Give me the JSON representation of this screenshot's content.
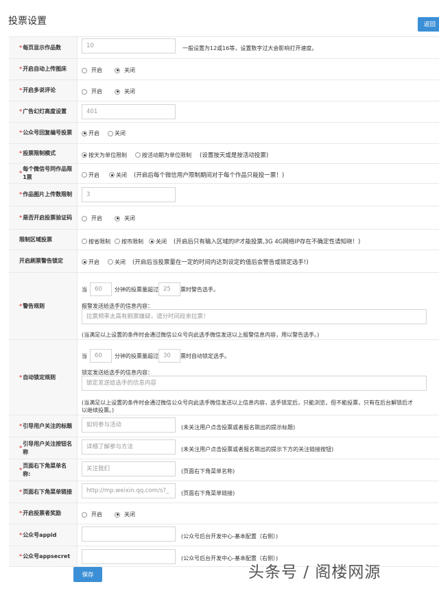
{
  "header": {
    "title": "投票设置",
    "back_label": "返回"
  },
  "rows": {
    "per_page": {
      "label": "每页显示作品数",
      "value": "10",
      "hint": "一般设置为12或16等，设置数字过大会影响打开速度。"
    },
    "auto_upload": {
      "label": "开启自动上传图床",
      "opt_on": "开启",
      "opt_off": "关闭",
      "selected": "关闭"
    },
    "multi_comment": {
      "label": "开启多说评论",
      "opt_on": "开启",
      "opt_off": "关闭",
      "selected": "关闭"
    },
    "ad_height": {
      "label": "广告幻灯高度设置",
      "value": "401"
    },
    "reply_number": {
      "label": "公众号回复编号投票",
      "opt_on": "开启",
      "opt_off": "关闭",
      "selected": "开启"
    },
    "vote_limit": {
      "label": "投票限制模式",
      "opt_day": "按天为单位限制",
      "opt_period": "按活动期为单位限制",
      "hint": "(设置按天或是按活动投票)",
      "selected": "按天为单位限制"
    },
    "one_vote": {
      "label": "每个微信号同作品限1票",
      "opt_on": "开启",
      "opt_off": "关闭",
      "hint": "(开启后每个微信用户限制期间对于每个作品只能投一票！)",
      "selected": "关闭"
    },
    "upload_limit": {
      "label": "作品图片上传数限制",
      "value": "3"
    },
    "captcha": {
      "label": "是否开启投票验证码",
      "opt_on": "开启",
      "opt_off": "关闭",
      "selected": "关闭"
    },
    "region": {
      "label": "限制区域投票",
      "opt_province": "按省限制",
      "opt_city": "按市限制",
      "opt_off": "关闭",
      "hint": "(开启后只有输入区域的IP才能投票,3G 4G网络IP存在不确定性请知晓！)",
      "selected": "关闭"
    },
    "brush_warn": {
      "label": "开启刷票警告锁定",
      "opt_on": "开启",
      "opt_off": "关闭",
      "hint": "(开启后当投票量在一定的时间内达到设定的值后会警告或锁定选手!)",
      "selected": "开启"
    },
    "warn_rule": {
      "label": "警告规则",
      "prefix": "当",
      "minutes": "60",
      "mid": "分钟的投票量超过",
      "count": "25",
      "suffix": "票时警告选手。",
      "msg_label": "报警发送给选手的信息内容：",
      "msg_placeholder": "拉票频率太高有刷票嫌疑，请分时间段来拉票！",
      "note": "(当满足以上设置的条件时会通过微信公众号向此选手微信发送以上报警信息内容，用以警告选手。)"
    },
    "lock_rule": {
      "label": "自动锁定规则",
      "prefix": "当",
      "minutes": "60",
      "mid": "分钟的投票量超过",
      "count": "30",
      "suffix": "票时自动锁定选手。",
      "msg_label": "锁定发送给选手的信息内容：",
      "msg_placeholder": "锁定发送给选手的信息内容",
      "note1": "(当满足以上设置的条件时会通过微信公众号向此选手微信发送以上信息内容，选手锁定后，只能浏览，但不能投票，只有在后台解锁后才",
      "note2": "以继续投票。)"
    },
    "follow_title": {
      "label": "引导用户关注的标题",
      "placeholder": "如何参与活动",
      "hint": "(未关注用户点击投票或者报名跳出的提示标题)"
    },
    "follow_button": {
      "label": "引导用户关注按钮名称",
      "placeholder": "详细了解参与方法",
      "hint": "(未关注用户点击投票或者报名跳出的提示下方的关注链接按钮)"
    },
    "menu_name": {
      "label": "页面右下角菜单名称:",
      "placeholder": "关注我们",
      "hint": "(页面右下角菜单名称)"
    },
    "menu_link": {
      "label": "页面右下角菜单链接",
      "placeholder": "http://mp.weixin.qq.com/s?_",
      "hint": "(页面右下角菜单链接)"
    },
    "reward": {
      "label": "开启投票者奖励",
      "opt_on": "开启",
      "opt_off": "关闭",
      "selected": "关闭"
    },
    "appid": {
      "label": "公众号appid",
      "value": "",
      "hint": "(公众号后台开发中心-基本配置（右侧）)"
    },
    "appsecret": {
      "label": "公众号appsecret",
      "value": "",
      "hint": "(公众号后台开发中心-基本配置（右侧）)"
    }
  },
  "save_label": "保存",
  "watermark": "头条号 / 阁楼网源"
}
